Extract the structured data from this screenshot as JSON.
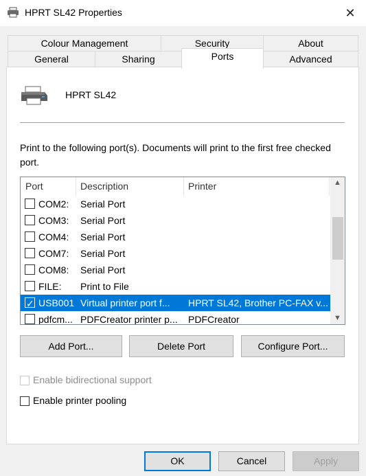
{
  "window": {
    "title": "HPRT SL42 Properties",
    "close_glyph": "✕",
    "icon": "printer-icon"
  },
  "tabs": {
    "row1": [
      "Colour Management",
      "Security",
      "About"
    ],
    "row2": [
      "General",
      "Sharing",
      "Ports",
      "Advanced"
    ],
    "active": "Ports"
  },
  "printer": {
    "name": "HPRT SL42"
  },
  "description": "Print to the following port(s). Documents will print to the first free checked port.",
  "ports_list": {
    "headers": [
      "Port",
      "Description",
      "Printer"
    ],
    "rows": [
      {
        "checked": false,
        "port": "COM2:",
        "description": "Serial Port",
        "printer": ""
      },
      {
        "checked": false,
        "port": "COM3:",
        "description": "Serial Port",
        "printer": ""
      },
      {
        "checked": false,
        "port": "COM4:",
        "description": "Serial Port",
        "printer": ""
      },
      {
        "checked": false,
        "port": "COM7:",
        "description": "Serial Port",
        "printer": ""
      },
      {
        "checked": false,
        "port": "COM8:",
        "description": "Serial Port",
        "printer": ""
      },
      {
        "checked": false,
        "port": "FILE:",
        "description": "Print to File",
        "printer": ""
      },
      {
        "checked": true,
        "selected": true,
        "port": "USB001",
        "description": "Virtual printer port f...",
        "printer": "HPRT SL42, Brother PC-FAX v..."
      },
      {
        "checked": false,
        "port": "pdfcm...",
        "description": "PDFCreator printer p...",
        "printer": "PDFCreator"
      }
    ],
    "scroll_up": "▲",
    "scroll_down": "▼"
  },
  "port_buttons": {
    "add": "Add Port...",
    "delete": "Delete Port",
    "configure": "Configure Port..."
  },
  "options": {
    "bidirectional": {
      "label": "Enable bidirectional support",
      "checked": false,
      "enabled": false
    },
    "pooling": {
      "label": "Enable printer pooling",
      "checked": false,
      "enabled": true
    }
  },
  "dialog_buttons": {
    "ok": "OK",
    "cancel": "Cancel",
    "apply": "Apply"
  },
  "colors": {
    "selection": "#0078d7",
    "default_button_border": "#0078d7"
  }
}
